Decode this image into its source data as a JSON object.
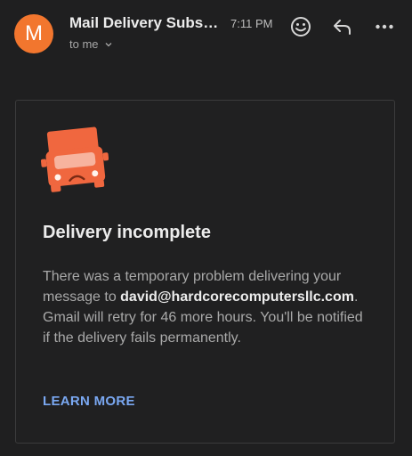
{
  "header": {
    "avatar_letter": "M",
    "sender": "Mail Delivery Subsystem",
    "time": "7:11 PM",
    "recipient": "to me",
    "icons": [
      "emoji-reaction-icon",
      "reply-icon",
      "more-icon"
    ]
  },
  "message": {
    "title": "Delivery incomplete",
    "body_before": "There was a temporary problem delivering your message to ",
    "email": "david@hardcorecomputersllc.com",
    "body_after": ". Gmail will retry for 46 more hours. You'll be notified if the delivery fails permanently.",
    "learn_more": "LEARN MORE"
  },
  "colors": {
    "avatar_bg": "#f2762e",
    "truck": "#f0673f",
    "link": "#7aa8f2",
    "background": "#1f1f20"
  }
}
